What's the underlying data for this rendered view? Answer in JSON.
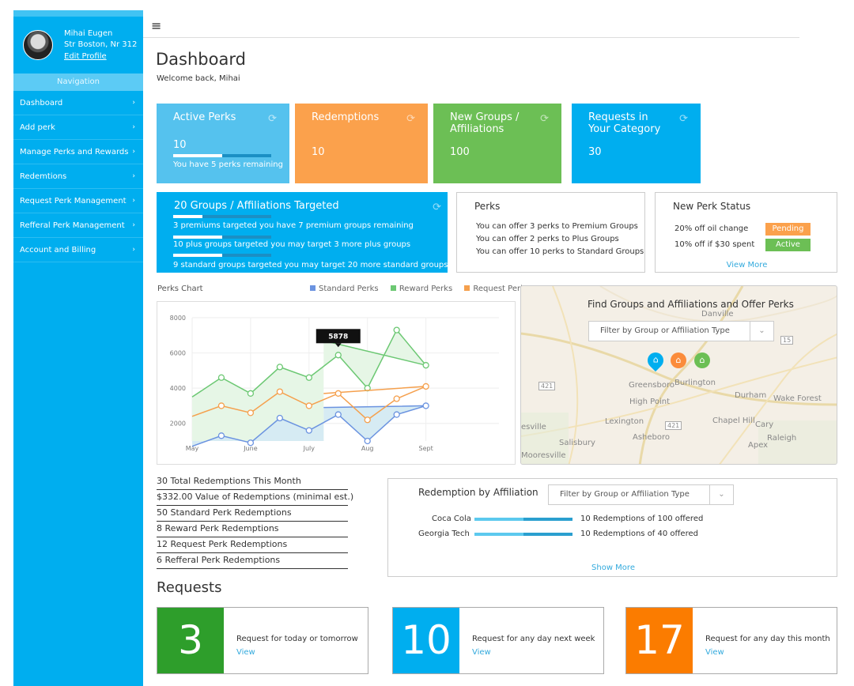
{
  "profile": {
    "name": "Mihai Eugen",
    "address": "Str Boston, Nr 312",
    "edit_label": "Edit Profile"
  },
  "sidebar": {
    "heading": "Navigation",
    "items": [
      {
        "label": "Dashboard"
      },
      {
        "label": "Add perk"
      },
      {
        "label": "Manage Perks and Rewards"
      },
      {
        "label": "Redemtions"
      },
      {
        "label": "Request Perk Management"
      },
      {
        "label": "Refferal Perk Management"
      },
      {
        "label": "Account and Billing"
      }
    ],
    "chevron": "›"
  },
  "header": {
    "title": "Dashboard",
    "welcome": "Welcome back, Mihai"
  },
  "tiles": [
    {
      "label": "Active Perks",
      "value": "10",
      "note": "You have 5 perks remaining",
      "progress": 0.5,
      "color": "#55c2ee"
    },
    {
      "label": "Redemptions",
      "value": "10",
      "color": "#fba14c"
    },
    {
      "label": "New Groups /\nAffiliations",
      "value": "100",
      "color": "#6cbf55"
    },
    {
      "label": "Requests in\nYour Category",
      "value": "30",
      "color": "#00aeef"
    }
  ],
  "groups": {
    "title": "20 Groups / Affiliations Targeted",
    "lines": [
      {
        "text": "3 premiums targeted you have 7 premium groups remaining",
        "progress": 0.3
      },
      {
        "text": "10 plus groups targeted you may target 3 more plus groups",
        "progress": 0.5
      },
      {
        "text": "9 standard groups targeted you may target 20 more standard groups",
        "progress": 0.5
      }
    ]
  },
  "perks": {
    "title": "Perks",
    "lines": [
      "You can offer 3 perks to Premium Groups",
      "You can offer 2 perks to Plus Groups",
      "You can offer 10 perks to Standard Groups"
    ]
  },
  "perk_status": {
    "title": "New Perk Status",
    "items": [
      {
        "label": "20% off oil change",
        "status": "Pending",
        "color": "#fba14c"
      },
      {
        "label": "10% off if $30 spent",
        "status": "Active",
        "color": "#6cbf55"
      }
    ],
    "view_more": "View More"
  },
  "chart_label": "Perks Chart",
  "chart_data": {
    "type": "area",
    "x": [
      1,
      2,
      3,
      4,
      5,
      6,
      7,
      8,
      9,
      10,
      11,
      12,
      13,
      14,
      15,
      16,
      17
    ],
    "x_ticks": [
      {
        "x": 1,
        "label": "May"
      },
      {
        "x": 5,
        "label": "June"
      },
      {
        "x": 9,
        "label": "July"
      },
      {
        "x": 13,
        "label": "Aug"
      },
      {
        "x": 17,
        "label": "Sept"
      }
    ],
    "xlim": [
      1,
      22
    ],
    "ylim": [
      1000,
      8000
    ],
    "y_ticks": [
      2000,
      4000,
      6000,
      8000
    ],
    "series": [
      {
        "name": "Standard Perks",
        "color": "#6b93e0",
        "fill": "#d6ebf3",
        "values": [
          700,
          1300,
          900,
          2300,
          1600,
          2500,
          1000,
          2500,
          3000,
          2900
        ]
      },
      {
        "name": "Reward Perks",
        "color": "#6cc873",
        "fill": "#e6f6e6",
        "values": [
          3500,
          4600,
          3700,
          5200,
          4600,
          5878,
          4000,
          7300,
          5300,
          6700
        ]
      },
      {
        "name": "Request Perks",
        "color": "#f5a04d",
        "fill": null,
        "values": [
          2400,
          3000,
          2600,
          3800,
          3000,
          3700,
          2200,
          3400,
          4100,
          3700
        ]
      }
    ],
    "tooltip": {
      "series": 1,
      "index": 5,
      "label": "5878"
    },
    "grid": true,
    "legend": "top-right"
  },
  "map": {
    "title": "Find Groups and Affiliations and Offer Perks",
    "filter_placeholder": "Filter by Group or Affiliation Type",
    "places": [
      "Danville",
      "Greensboro",
      "Burlington",
      "Durham",
      "Wake Forest",
      "High Point",
      "Lexington",
      "Chapel Hill",
      "Cary",
      "Raleigh",
      "Asheboro",
      "Salisbury",
      "Apex",
      "esville",
      "Mooresville"
    ],
    "road_labels": [
      "421",
      "421",
      "15"
    ],
    "pins": [
      {
        "type": "location",
        "color": "#00aeef"
      },
      {
        "type": "home",
        "color": "#fb8c3b"
      },
      {
        "type": "home",
        "color": "#6cbf55"
      }
    ]
  },
  "redemptions": [
    "30 Total Redemptions This Month",
    "$332.00 Value of Redemptions (minimal est.)",
    "50 Standard Perk Redemptions",
    "8 Reward Perk Redemptions",
    "12 Request Perk Redemptions",
    "6 Refferal Perk Redemptions"
  ],
  "affiliation": {
    "title": "Redemption by Affiliation",
    "filter_placeholder": "Filter by Group or Affiliation Type",
    "rows": [
      {
        "name": "Coca Cola",
        "text": "10 Redemptions of 100 offered",
        "progress": 0.5
      },
      {
        "name": "Georgia Tech",
        "text": "10 Redemptions of 40 offered",
        "progress": 0.5
      }
    ],
    "show_more": "Show More"
  },
  "requests": {
    "title": "Requests",
    "cards": [
      {
        "count": "3",
        "text": "Request for today or tomorrow",
        "view": "View",
        "color": "#2e9e2b"
      },
      {
        "count": "10",
        "text": "Request for any day next week",
        "view": "View",
        "color": "#00aeef"
      },
      {
        "count": "17",
        "text": "Request for any day this month",
        "view": "View",
        "color": "#fb7c00"
      }
    ]
  }
}
